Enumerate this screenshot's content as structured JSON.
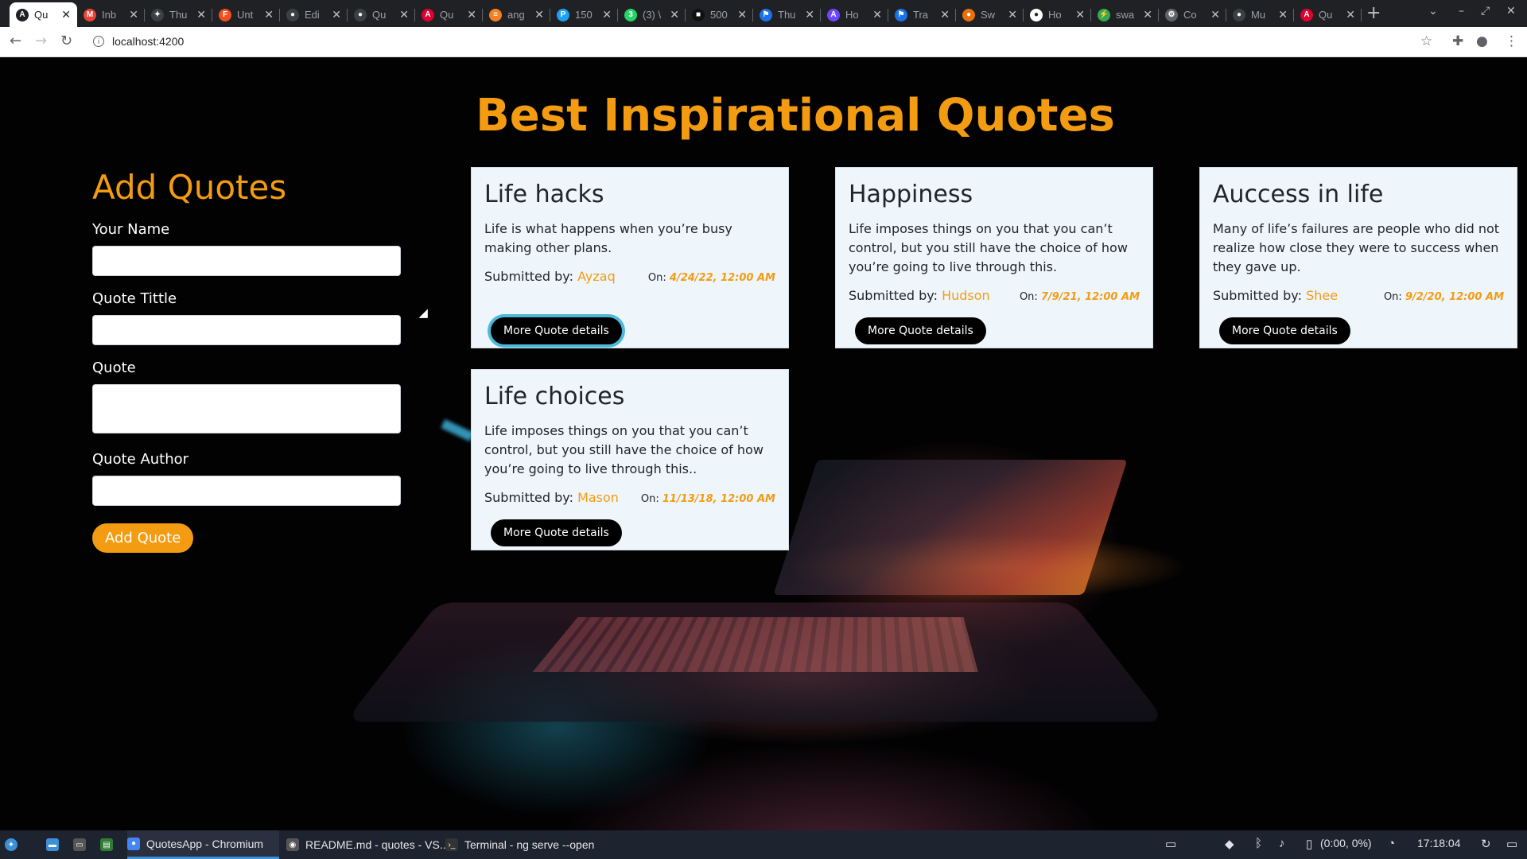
{
  "browser": {
    "tabs": [
      {
        "title": "Qu",
        "color": "#202124",
        "glyph": "A",
        "active": true
      },
      {
        "title": "Inb",
        "color": "#ea4335",
        "glyph": "M"
      },
      {
        "title": "Thu",
        "color": "#3c4043",
        "glyph": "✦"
      },
      {
        "title": "Unt",
        "color": "#f24e1e",
        "glyph": "F"
      },
      {
        "title": "Edi",
        "color": "#3c4043",
        "glyph": "●"
      },
      {
        "title": "Qu",
        "color": "#3c4043",
        "glyph": "●"
      },
      {
        "title": "Qu",
        "color": "#dd0031",
        "glyph": "A"
      },
      {
        "title": "ang",
        "color": "#f48024",
        "glyph": "≡"
      },
      {
        "title": "150",
        "color": "#1da1f2",
        "glyph": "P"
      },
      {
        "title": "(3) \\",
        "color": "#25d366",
        "glyph": "3"
      },
      {
        "title": "500",
        "color": "#111111",
        "glyph": "■"
      },
      {
        "title": "Thu",
        "color": "#1a73e8",
        "glyph": "⚑"
      },
      {
        "title": "Ho",
        "color": "#6c47ff",
        "glyph": "A"
      },
      {
        "title": "Tra",
        "color": "#1a73e8",
        "glyph": "⚑"
      },
      {
        "title": "Sw",
        "color": "#e8710a",
        "glyph": "●"
      },
      {
        "title": "Ho",
        "color": "#ffffff",
        "glyph": "●"
      },
      {
        "title": "swa",
        "color": "#34a853",
        "glyph": "⚡"
      },
      {
        "title": "Co",
        "color": "#5f6368",
        "glyph": "⚙"
      },
      {
        "title": "Mu",
        "color": "#3c4043",
        "glyph": "●"
      },
      {
        "title": "Qu",
        "color": "#dd0031",
        "glyph": "A"
      }
    ],
    "url": "localhost:4200"
  },
  "page": {
    "title": "Best Inspirational Quotes",
    "form": {
      "heading": "Add Quotes",
      "name_label": "Your Name",
      "title_label": "Quote Tittle",
      "quote_label": "Quote",
      "author_label": "Quote Author",
      "submit_label": "Add Quote"
    },
    "quotes": [
      {
        "title": "Life hacks",
        "text": "Life is what happens when you’re busy making other plans.",
        "by_label": "Submitted by:",
        "author": "Ayzaq",
        "on_label": "On:",
        "date": "4/24/22, 12:00 AM",
        "button": "More Quote details"
      },
      {
        "title": "Happiness",
        "text": "Life imposes things on you that you can’t control, but you still have the choice of how you’re going to live through this.",
        "by_label": "Submitted by:",
        "author": "Hudson",
        "on_label": "On:",
        "date": "7/9/21, 12:00 AM",
        "button": "More Quote details"
      },
      {
        "title": "Auccess in life",
        "text": "Many of life’s failures are people who did not realize how close they were to success when they gave up.",
        "by_label": "Submitted by:",
        "author": "Shee",
        "on_label": "On:",
        "date": "9/2/20, 12:00 AM",
        "button": "More Quote details"
      },
      {
        "title": "Life choices",
        "text": "Life imposes things on you that you can’t control, but you still have the choice of how you’re going to live through this..",
        "by_label": "Submitted by:",
        "author": "Mason",
        "on_label": "On:",
        "date": "11/13/18, 12:00 AM",
        "button": "More Quote details"
      }
    ]
  },
  "taskbar": {
    "windows": [
      {
        "label": "QuotesApp - Chromium",
        "active": true
      },
      {
        "label": "README.md - quotes - VS..."
      },
      {
        "label": "Terminal - ng serve --open"
      }
    ],
    "battery": "(0:00, 0%)",
    "clock": "17:18:04"
  }
}
